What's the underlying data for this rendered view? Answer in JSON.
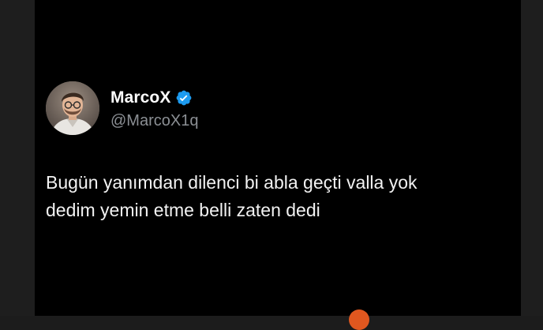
{
  "profile": {
    "display_name": "MarcoX",
    "handle": "@MarcoX1q",
    "verified": true,
    "avatar_icon": "user-photo-icon",
    "verified_icon": "verified-badge-icon"
  },
  "tweet": {
    "line1": "Bugün yanımdan dilenci bi abla geçti valla yok",
    "line2": "dedim yemin etme belli zaten dedi"
  },
  "colors": {
    "background": "#000000",
    "name": "#ffffff",
    "handle": "#8b8f94",
    "verified": "#1d9bf0",
    "fragment": "#e0571f"
  }
}
